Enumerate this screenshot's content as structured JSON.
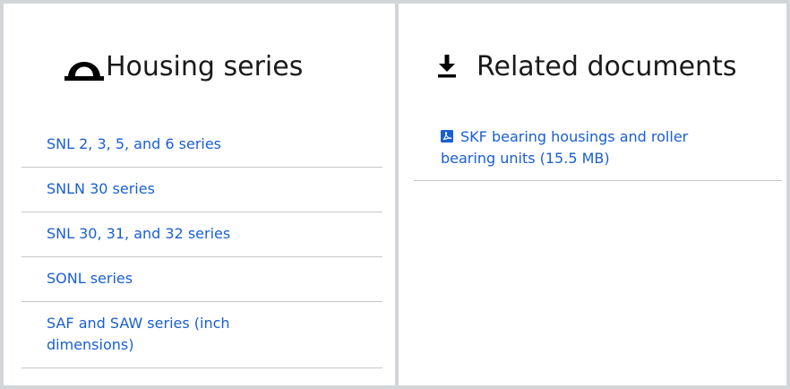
{
  "housing": {
    "title": "Housing series",
    "icon": "housing-icon",
    "items": [
      {
        "label": "SNL 2, 3, 5, and 6 series"
      },
      {
        "label": "SNLN 30 series"
      },
      {
        "label": "SNL 30, 31, and 32 series"
      },
      {
        "label": "SONL series"
      },
      {
        "label": "SAF and SAW series (inch dimensions)"
      }
    ]
  },
  "documents": {
    "title": "Related documents",
    "icon": "download-icon",
    "items": [
      {
        "label": "SKF bearing housings and roller bearing units (15.5 MB)",
        "icon": "pdf-icon"
      }
    ]
  },
  "colors": {
    "link": "#1a5fd1",
    "border": "#d3d6d9",
    "divider": "#c4c7ca",
    "text": "#1a1a1a"
  }
}
